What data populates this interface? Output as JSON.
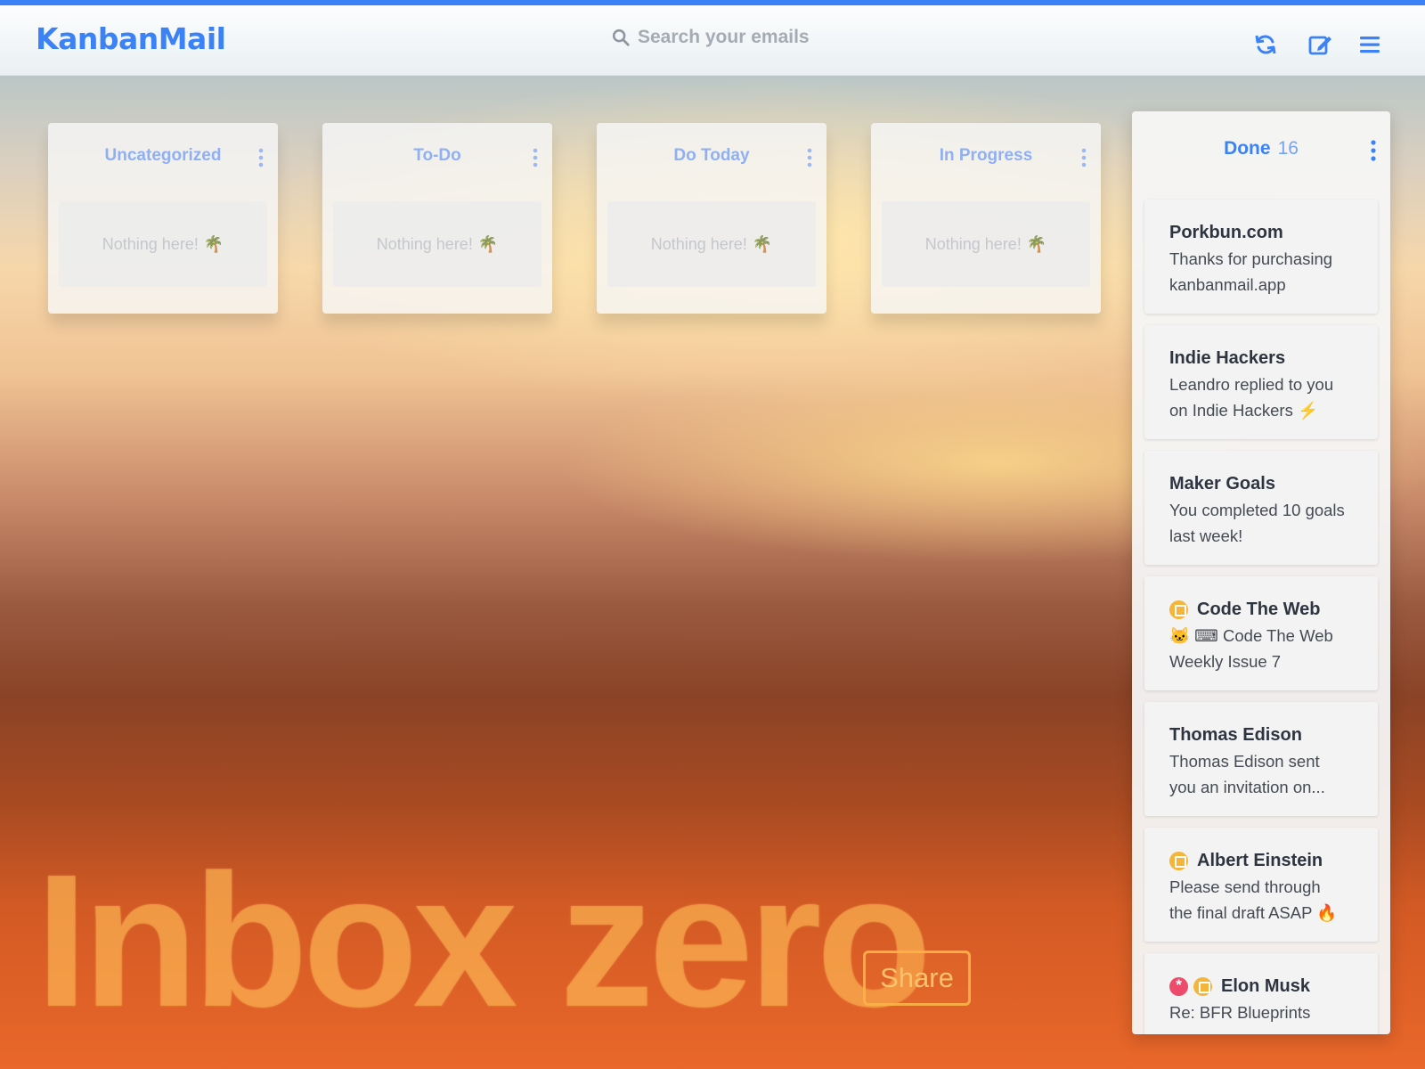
{
  "app": {
    "logo": "KanbanMail"
  },
  "search": {
    "placeholder": "Search your emails",
    "value": ""
  },
  "header_icons": [
    "refresh-icon",
    "compose-icon",
    "menu-icon"
  ],
  "accent_color": "#3b82f6",
  "columns": [
    {
      "title": "Uncategorized",
      "empty_text": "Nothing here!",
      "empty_icon": "🌴"
    },
    {
      "title": "To-Do",
      "empty_text": "Nothing here!",
      "empty_icon": "🌴"
    },
    {
      "title": "Do Today",
      "empty_text": "Nothing here!",
      "empty_icon": "🌴"
    },
    {
      "title": "In Progress",
      "empty_text": "Nothing here!",
      "empty_icon": "🌴"
    }
  ],
  "done": {
    "title": "Done",
    "count": "16",
    "cards": [
      {
        "sender": "Porkbun.com",
        "line1": "Thanks for purchasing",
        "line2": "kanbanmail.app"
      },
      {
        "sender": "Indie Hackers",
        "line1": "Leandro replied to you",
        "line2": "on Indie Hackers ⚡"
      },
      {
        "sender": "Maker Goals",
        "line1": "You completed 10 goals",
        "line2": "last week!"
      },
      {
        "sender": "Code The Web",
        "line1": "🐱 ⌨ Code The Web",
        "line2": "Weekly Issue 7",
        "badges": [
          "flag"
        ]
      },
      {
        "sender": "Thomas Edison",
        "line1": "Thomas Edison sent",
        "line2": "you an invitation on..."
      },
      {
        "sender": "Albert Einstein",
        "line1": "Please send through",
        "line2": "the final draft ASAP 🔥",
        "badges": [
          "flag"
        ]
      },
      {
        "sender": "Elon Musk",
        "line1": "Re: BFR Blueprints",
        "line2": "",
        "badges": [
          "star",
          "flag"
        ]
      }
    ]
  },
  "hero": {
    "text": "Inbox zero",
    "share_label": "Share"
  }
}
